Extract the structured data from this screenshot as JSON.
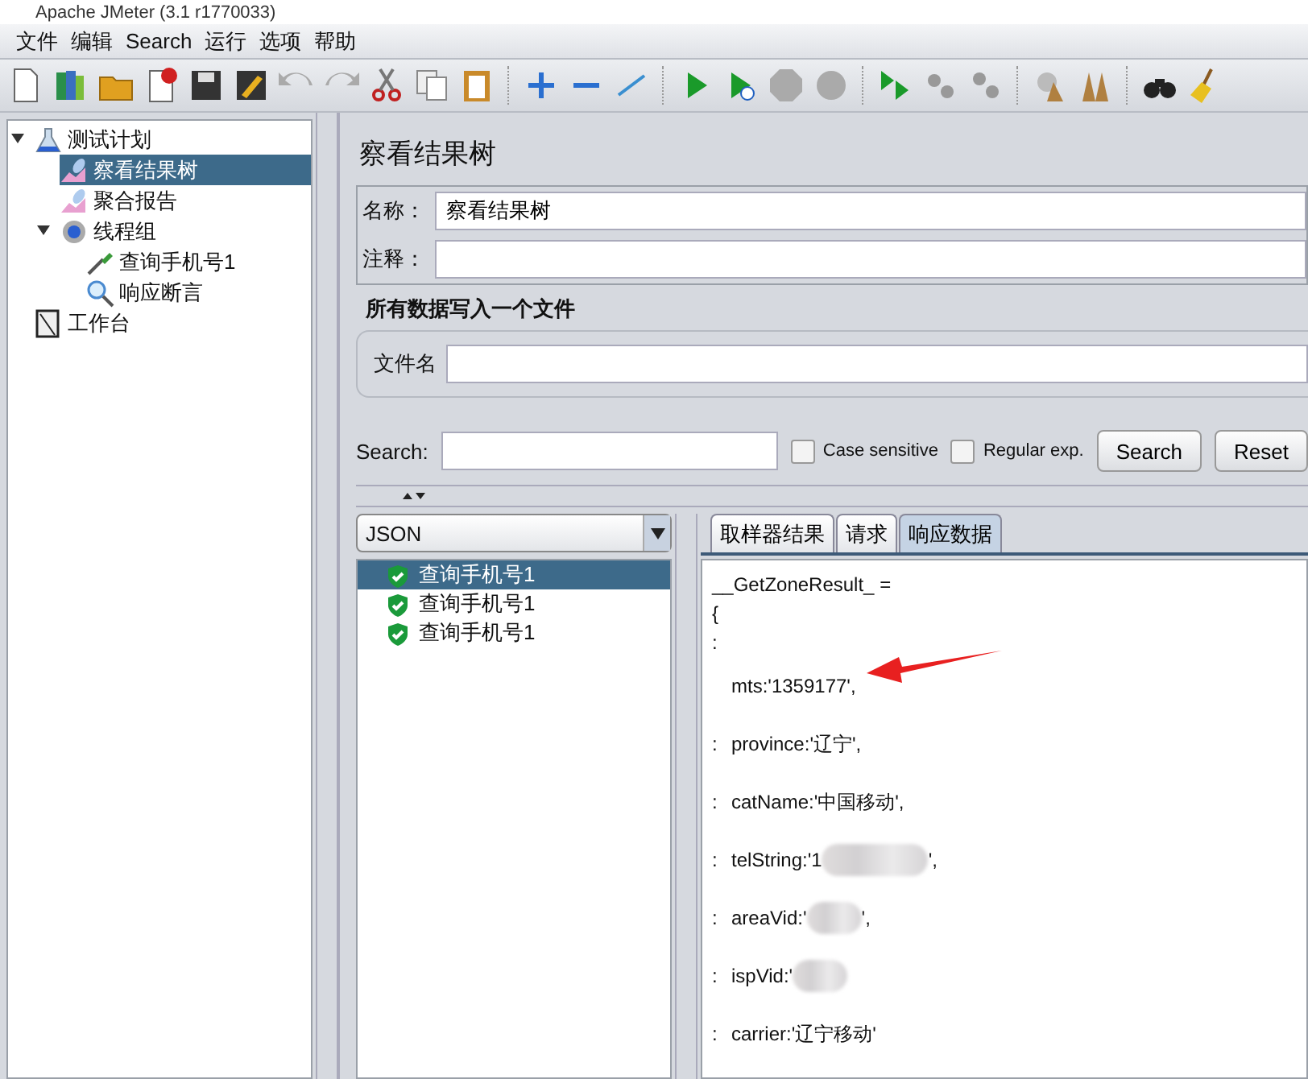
{
  "window": {
    "title": "Apache JMeter (3.1 r1770033)"
  },
  "menu": [
    "文件",
    "编辑",
    "Search",
    "运行",
    "选项",
    "帮助"
  ],
  "tree": [
    {
      "label": "测试计划",
      "kind": "plan",
      "expanded": true,
      "selected": false,
      "children": [
        {
          "label": "察看结果树",
          "kind": "listener",
          "selected": true
        },
        {
          "label": "聚合报告",
          "kind": "listener",
          "selected": false
        },
        {
          "label": "线程组",
          "kind": "threads",
          "expanded": true,
          "selected": false,
          "children": [
            {
              "label": "查询手机号1",
              "kind": "sampler",
              "selected": false
            },
            {
              "label": "响应断言",
              "kind": "assertion",
              "selected": false
            }
          ]
        }
      ]
    },
    {
      "label": "工作台",
      "kind": "workbench",
      "selected": false
    }
  ],
  "panel": {
    "title": "察看结果树",
    "name_label": "名称：",
    "name_value": "察看结果树",
    "comment_label": "注释：",
    "file_group_title": "所有数据写入一个文件",
    "file_label": "文件名",
    "search_label": "Search:",
    "case_sensitive": {
      "label": "Case sensitive",
      "checked": false
    },
    "regex": {
      "label": "Regular exp.",
      "checked": false
    },
    "search_button": "Search",
    "reset_button": "Reset"
  },
  "renderer": "JSON",
  "results": [
    {
      "label": "查询手机号1",
      "selected": true
    },
    {
      "label": "查询手机号1",
      "selected": false
    },
    {
      "label": "查询手机号1",
      "selected": false
    }
  ],
  "tabs": [
    {
      "label": "取样器结果",
      "selected": false
    },
    {
      "label": "请求",
      "selected": false
    },
    {
      "label": "响应数据",
      "selected": true
    }
  ],
  "response": [
    {
      "text": "__GetZoneResult_ ="
    },
    {
      "text": "{"
    },
    {
      "text": ":"
    },
    {
      "kind": "field",
      "text": "mts:'1359177',"
    },
    {
      "kind": "field",
      "prefix": ":",
      "text": "province:'辽宁',"
    },
    {
      "kind": "field",
      "prefix": ":",
      "text": "catName:'中国移动',"
    },
    {
      "kind": "field",
      "prefix": ":",
      "text": "telString:'1",
      "redacted": true,
      "suffix": "',"
    },
    {
      "kind": "field",
      "prefix": ":",
      "text": "areaVid:'",
      "redacted": true,
      "suffix": "',"
    },
    {
      "kind": "field",
      "prefix": ":",
      "text": "ispVid:'",
      "redacted": true
    },
    {
      "kind": "field",
      "prefix": ":",
      "text": "carrier:'辽宁移动'"
    }
  ]
}
